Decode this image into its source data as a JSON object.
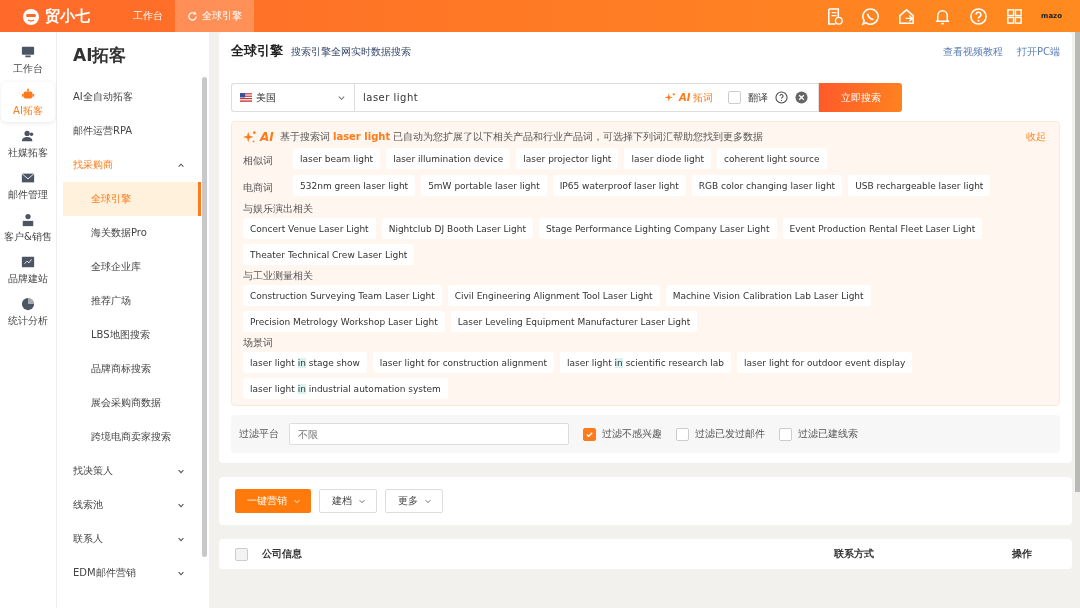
{
  "topbar": {
    "logo": "贸小七",
    "tabs": [
      {
        "label": "工作台",
        "selected": false
      },
      {
        "label": "全球引擎",
        "selected": true
      }
    ],
    "avatar": "mazo"
  },
  "rail": [
    {
      "label": "工作台",
      "selected": false
    },
    {
      "label": "AI拓客",
      "selected": true
    },
    {
      "label": "社媒拓客",
      "selected": false
    },
    {
      "label": "邮件管理",
      "selected": false
    },
    {
      "label": "客户&销售",
      "selected": false
    },
    {
      "label": "品牌建站",
      "selected": false
    },
    {
      "label": "统计分析",
      "selected": false
    }
  ],
  "sidebar": {
    "title": "AI拓客",
    "items": [
      {
        "label": "AI全自动拓客",
        "selected": false
      },
      {
        "label": "邮件运营RPA",
        "selected": false
      },
      {
        "label": "找采购商",
        "selected": false,
        "expanded": true,
        "children": [
          {
            "label": "全球引擎",
            "selected": true
          },
          {
            "label": "海关数据Pro",
            "selected": false
          },
          {
            "label": "全球企业库",
            "selected": false
          },
          {
            "label": "推荐广场",
            "selected": false
          },
          {
            "label": "LBS地图搜索",
            "selected": false
          },
          {
            "label": "品牌商标搜索",
            "selected": false
          },
          {
            "label": "展会采购商数据",
            "selected": false
          },
          {
            "label": "跨境电商卖家搜索",
            "selected": false
          }
        ]
      },
      {
        "label": "找决策人",
        "selected": false,
        "expanded": false
      },
      {
        "label": "线索池",
        "selected": false,
        "expanded": false
      },
      {
        "label": "联系人",
        "selected": false,
        "expanded": false
      },
      {
        "label": "EDM邮件营销",
        "selected": false,
        "expanded": false
      }
    ]
  },
  "header": {
    "title": "全球引擎",
    "subtitle": "搜索引擎全网实时数据搜索",
    "links": [
      "查看视频教程",
      "打开PC端"
    ]
  },
  "search": {
    "country": "美国",
    "value": "laser light",
    "ai_label": "AI",
    "ai_action": "拓词",
    "translate": {
      "label": "翻译",
      "checked": false
    },
    "button": "立即搜索"
  },
  "ai_panel": {
    "badge": "AI",
    "intro": "基于搜索词 **laser light** 已自动为您扩展了以下相关产品和行业产品词，可选择下列词汇帮助您找到更多数据",
    "collapse": "收起",
    "groups": [
      {
        "kind": "inline",
        "label": "相似词",
        "tags": [
          {
            "text": "laser beam light"
          },
          {
            "text": "laser illumination device"
          },
          {
            "text": "laser projector light"
          },
          {
            "text": "laser diode light"
          },
          {
            "text": "coherent light source"
          }
        ]
      },
      {
        "kind": "inline",
        "label": "电商词",
        "tags": [
          {
            "text": "532nm green laser light"
          },
          {
            "text": "5mW portable laser light"
          },
          {
            "text": "IP65 waterproof laser light"
          },
          {
            "text": "RGB color changing laser light"
          },
          {
            "text": "USB rechargeable laser light"
          }
        ]
      },
      {
        "kind": "block",
        "label": "与娱乐演出相关",
        "tags": [
          {
            "text": "Concert Venue Laser Light"
          },
          {
            "text": "Nightclub DJ Booth Laser Light"
          },
          {
            "text": "Stage Performance Lighting Company Laser Light"
          },
          {
            "text": "Event Production Rental Fleet Laser Light"
          },
          {
            "text": "Theater Technical Crew Laser Light"
          }
        ]
      },
      {
        "kind": "block",
        "label": "与工业测量相关",
        "tags": [
          {
            "text": "Construction Surveying Team Laser Light"
          },
          {
            "text": "Civil Engineering Alignment Tool Laser Light"
          },
          {
            "text": "Machine Vision Calibration Lab Laser Light"
          },
          {
            "text": "Precision Metrology Workshop Laser Light"
          },
          {
            "text": "Laser Leveling Equipment Manufacturer Laser Light"
          }
        ]
      },
      {
        "kind": "block",
        "label": "场景词",
        "tags": [
          {
            "parts": [
              {
                "text": "laser light ",
                "highlighted": false
              },
              {
                "text": "in",
                "highlighted": true
              },
              {
                "text": " stage show",
                "highlighted": false
              }
            ]
          },
          {
            "parts": [
              {
                "text": "laser light for construction alignment",
                "highlighted": false
              }
            ]
          },
          {
            "parts": [
              {
                "text": "laser light ",
                "highlighted": false
              },
              {
                "text": "in",
                "highlighted": true
              },
              {
                "text": " scientific research lab",
                "highlighted": false
              }
            ]
          },
          {
            "parts": [
              {
                "text": "laser light for outdoor event display",
                "highlighted": false
              }
            ]
          },
          {
            "parts": [
              {
                "text": "laser light ",
                "highlighted": false
              },
              {
                "text": "in",
                "highlighted": true
              },
              {
                "text": " industrial automation system",
                "highlighted": false
              }
            ]
          }
        ]
      }
    ]
  },
  "filter": {
    "label": "过滤平台",
    "placeholder": "不限",
    "options": [
      {
        "label": "过滤不感兴趣",
        "checked": true
      },
      {
        "label": "过滤已发过邮件",
        "checked": false
      },
      {
        "label": "过滤已建线索",
        "checked": false
      }
    ]
  },
  "actions": [
    {
      "label": "一键营销",
      "kind": "primary"
    },
    {
      "label": "建档",
      "kind": "plain"
    },
    {
      "label": "更多",
      "kind": "plain"
    }
  ],
  "table": {
    "select_all": false,
    "columns": [
      "公司信息",
      "联系方式",
      "操作"
    ]
  }
}
